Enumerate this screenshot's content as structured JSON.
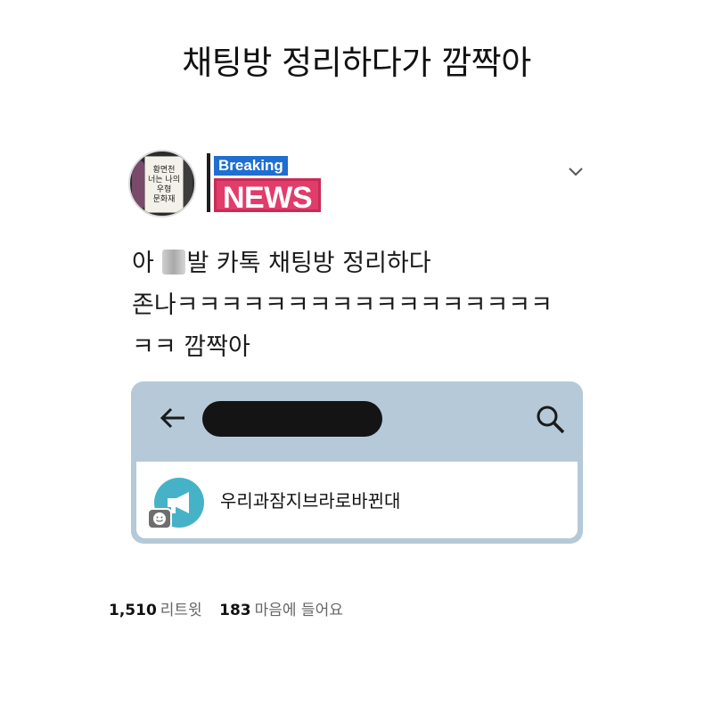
{
  "headline": "채팅방 정리하다가 깜짝아",
  "profile": {
    "avatar_sign_lines": [
      "황면천",
      "너는 나의",
      "우형",
      "문화재"
    ],
    "logo_breaking": "Breaking",
    "logo_news": "NEWS",
    "menu_icon": "chevron-down-icon"
  },
  "tweet": {
    "line1_before_blur": "아 ",
    "line1_after_blur": "발 카톡 채팅방 정리하다",
    "line2": "존나ㅋㅋㅋㅋㅋㅋㅋㅋㅋㅋㅋㅋㅋㅋㅋㅋㅋ",
    "line3": "ㅋㅋ 깜짝아"
  },
  "screenshot": {
    "back_icon": "arrow-left-icon",
    "search_icon": "search-icon",
    "chat_room_name": "우리과잠지브라로바뀐대",
    "chat_avatar_icon": "megaphone-icon",
    "badge_icon": "smiley-icon",
    "header_color": "#b5c9d8",
    "avatar_color": "#46b2c8"
  },
  "stats": {
    "retweets_count": "1,510",
    "retweets_label": "리트윗",
    "likes_count": "183",
    "likes_label": "마음에 들어요"
  },
  "colors": {
    "breaking_blue": "#1f6fd0",
    "news_pink": "#e23c6a"
  }
}
